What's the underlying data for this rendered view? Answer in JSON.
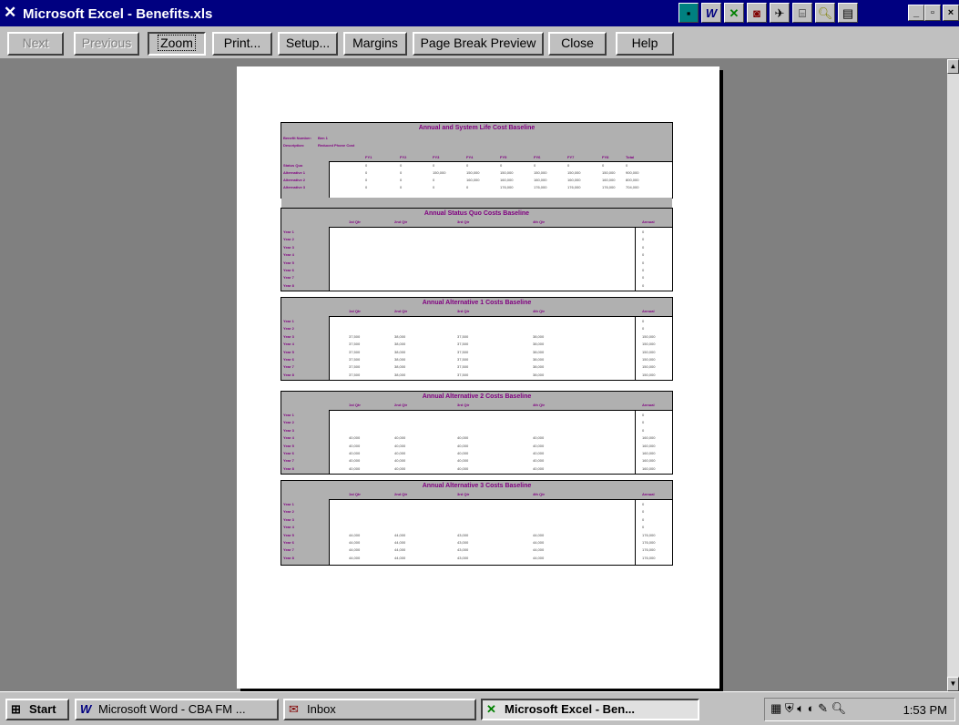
{
  "window": {
    "title": "Microsoft Excel - Benefits.xls",
    "icons": [
      "office-shortcut-icon",
      "word-icon",
      "excel-icon",
      "powerpoint-icon",
      "outlook-icon",
      "access-icon",
      "find-icon",
      "bookshelf-icon"
    ],
    "buttons": {
      "minimize": "_",
      "restore": "▫",
      "close": "×"
    }
  },
  "toolbar": {
    "next": "Next",
    "previous": "Previous",
    "zoom": "Zoom",
    "print": "Print...",
    "setup": "Setup...",
    "margins": "Margins",
    "page_break_preview": "Page Break Preview",
    "close": "Close",
    "help": "Help"
  },
  "sheet": {
    "summary": {
      "title": "Annual and System Life Cost Baseline",
      "benefit_number_label": "Benefit Number:",
      "benefit_number_value": "Ben 1",
      "description_label": "Description:",
      "description_value": "Reduced Phone Cost",
      "columns": [
        "FY1",
        "FY2",
        "FY3",
        "FY4",
        "FY5",
        "FY6",
        "FY7",
        "FY8",
        "Total"
      ],
      "rows": [
        {
          "label": "Status Quo",
          "values": [
            "0",
            "0",
            "0",
            "0",
            "0",
            "0",
            "0",
            "0",
            "0"
          ]
        },
        {
          "label": "Alternative 1",
          "values": [
            "0",
            "0",
            "150,000",
            "150,000",
            "150,000",
            "150,000",
            "150,000",
            "150,000",
            "900,000"
          ]
        },
        {
          "label": "Alternative 2",
          "values": [
            "0",
            "0",
            "0",
            "160,000",
            "160,000",
            "160,000",
            "160,000",
            "160,000",
            "800,000"
          ]
        },
        {
          "label": "Alternative 3",
          "values": [
            "0",
            "0",
            "0",
            "0",
            "176,000",
            "176,000",
            "176,000",
            "176,000",
            "704,000"
          ]
        }
      ]
    },
    "quarter_headers": [
      "1st Qtr",
      "2nd Qtr",
      "3rd Qtr",
      "4th Qtr",
      "Annual"
    ],
    "year_labels": [
      "Year 1",
      "Year 2",
      "Year 3",
      "Year 4",
      "Year 5",
      "Year 6",
      "Year 7",
      "Year 8"
    ],
    "sections": [
      {
        "title": "Annual Status Quo Costs Baseline",
        "rows": [
          [
            "",
            "",
            "",
            "",
            "0"
          ],
          [
            "",
            "",
            "",
            "",
            "0"
          ],
          [
            "",
            "",
            "",
            "",
            "0"
          ],
          [
            "",
            "",
            "",
            "",
            "0"
          ],
          [
            "",
            "",
            "",
            "",
            "0"
          ],
          [
            "",
            "",
            "",
            "",
            "0"
          ],
          [
            "",
            "",
            "",
            "",
            "0"
          ],
          [
            "",
            "",
            "",
            "",
            "0"
          ]
        ]
      },
      {
        "title": "Annual Alternative 1 Costs Baseline",
        "rows": [
          [
            "",
            "",
            "",
            "",
            "0"
          ],
          [
            "",
            "",
            "",
            "",
            "0"
          ],
          [
            "37,500",
            "38,000",
            "37,500",
            "38,000",
            "150,000"
          ],
          [
            "37,500",
            "38,000",
            "37,500",
            "38,000",
            "150,000"
          ],
          [
            "37,500",
            "38,000",
            "37,500",
            "38,000",
            "150,000"
          ],
          [
            "37,500",
            "38,000",
            "37,500",
            "38,000",
            "150,000"
          ],
          [
            "37,500",
            "38,000",
            "37,500",
            "38,000",
            "150,000"
          ],
          [
            "37,500",
            "38,000",
            "37,500",
            "38,000",
            "150,000"
          ]
        ]
      },
      {
        "title": "Annual Alternative 2 Costs Baseline",
        "rows": [
          [
            "",
            "",
            "",
            "",
            "0"
          ],
          [
            "",
            "",
            "",
            "",
            "0"
          ],
          [
            "",
            "",
            "",
            "",
            "0"
          ],
          [
            "40,000",
            "40,000",
            "40,000",
            "40,000",
            "160,000"
          ],
          [
            "40,000",
            "40,000",
            "40,000",
            "40,000",
            "160,000"
          ],
          [
            "40,000",
            "40,000",
            "40,000",
            "40,000",
            "160,000"
          ],
          [
            "40,000",
            "40,000",
            "40,000",
            "40,000",
            "160,000"
          ],
          [
            "40,000",
            "40,000",
            "40,000",
            "40,000",
            "160,000"
          ]
        ]
      },
      {
        "title": "Annual Alternative 3 Costs Baseline",
        "rows": [
          [
            "",
            "",
            "",
            "",
            "0"
          ],
          [
            "",
            "",
            "",
            "",
            "0"
          ],
          [
            "",
            "",
            "",
            "",
            "0"
          ],
          [
            "",
            "",
            "",
            "",
            "0"
          ],
          [
            "44,000",
            "44,000",
            "43,000",
            "44,000",
            "176,000"
          ],
          [
            "44,000",
            "44,000",
            "43,000",
            "44,000",
            "176,000"
          ],
          [
            "44,000",
            "44,000",
            "43,000",
            "44,000",
            "176,000"
          ],
          [
            "44,000",
            "44,000",
            "43,000",
            "44,000",
            "176,000"
          ]
        ]
      }
    ]
  },
  "taskbar": {
    "start": "Start",
    "tasks": [
      {
        "label": "Microsoft Word - CBA FM ...",
        "icon": "word-icon"
      },
      {
        "label": "Inbox",
        "icon": "inbox-icon"
      },
      {
        "label": "Microsoft Excel - Ben...",
        "icon": "excel-icon"
      }
    ],
    "clock": "1:53 PM"
  }
}
